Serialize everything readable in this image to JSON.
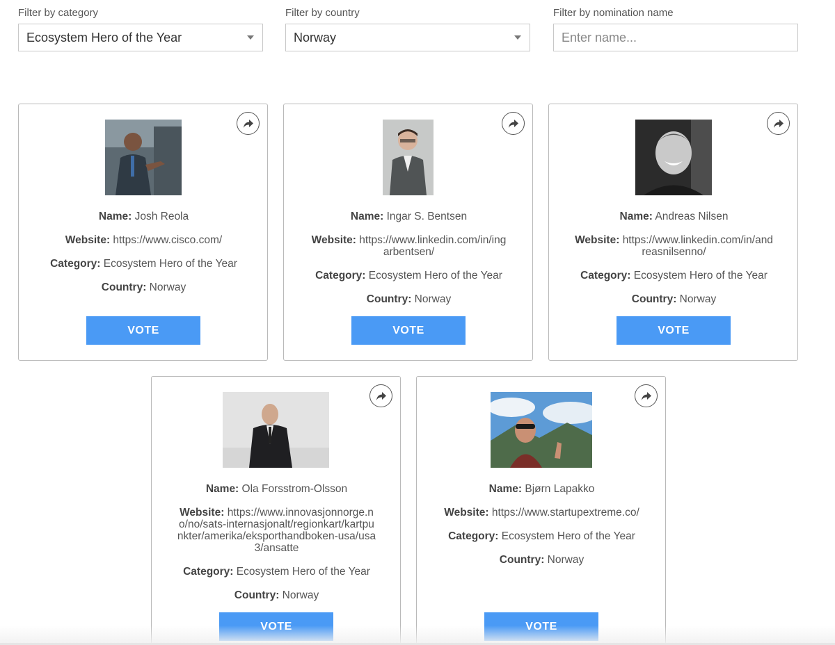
{
  "filters": {
    "category": {
      "label": "Filter by category",
      "value": "Ecosystem Hero of the Year"
    },
    "country": {
      "label": "Filter by country",
      "value": "Norway"
    },
    "name": {
      "label": "Filter by nomination name",
      "placeholder": "Enter name..."
    }
  },
  "labels": {
    "name": "Name:",
    "website": "Website:",
    "category": "Category:",
    "country": "Country:",
    "vote": "VOTE"
  },
  "nominees": [
    {
      "name": "Josh Reola",
      "website": "https://www.cisco.com/",
      "category": "Ecosystem Hero of the Year",
      "country": "Norway"
    },
    {
      "name": "Ingar S. Bentsen",
      "website": "https://www.linkedin.com/in/ingarbentsen/",
      "category": "Ecosystem Hero of the Year",
      "country": "Norway"
    },
    {
      "name": "Andreas Nilsen",
      "website": "https://www.linkedin.com/in/andreasnilsenno/",
      "category": "Ecosystem Hero of the Year",
      "country": "Norway"
    },
    {
      "name": "Ola Forsstrom-Olsson",
      "website": "https://www.innovasjonnorge.no/no/sats-internasjonalt/regionkart/kartpunkter/amerika/eksporthandboken-usa/usa3/ansatte",
      "category": "Ecosystem Hero of the Year",
      "country": "Norway"
    },
    {
      "name": "Bjørn Lapakko",
      "website": "https://www.startupextreme.co/",
      "category": "Ecosystem Hero of the Year",
      "country": "Norway"
    }
  ],
  "icons": {
    "share": "share-arrow-icon",
    "dropdown": "chevron-down-icon"
  },
  "colors": {
    "vote_button": "#4a9af5",
    "card_border": "#b9b9b9"
  }
}
